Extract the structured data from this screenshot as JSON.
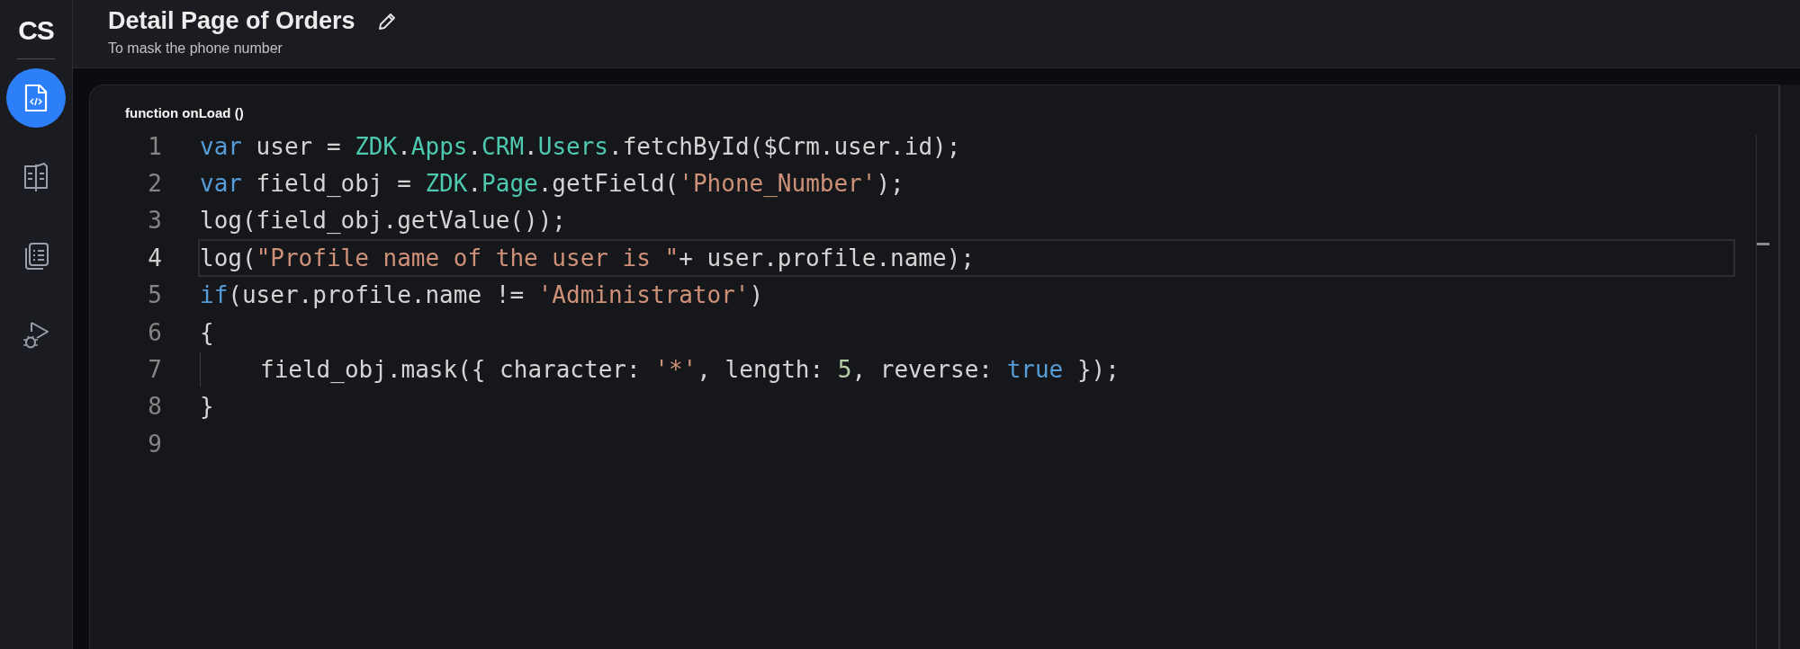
{
  "sidebar": {
    "logo": "CS",
    "items": [
      {
        "kind": "code",
        "selected": true
      },
      {
        "kind": "book",
        "selected": false
      },
      {
        "kind": "list",
        "selected": false
      },
      {
        "kind": "debug",
        "selected": false
      }
    ]
  },
  "header": {
    "title": "Detail Page of Orders",
    "subtitle": "To mask the phone number"
  },
  "editor": {
    "function_label": "function onLoad ()",
    "lines": [
      {
        "number": "1",
        "current": false,
        "indent_guide": false,
        "tokens": [
          {
            "kind": "keyword",
            "text": "var"
          },
          {
            "kind": "plain",
            "text": " user = "
          },
          {
            "kind": "type",
            "text": "ZDK"
          },
          {
            "kind": "plain",
            "text": "."
          },
          {
            "kind": "type",
            "text": "Apps"
          },
          {
            "kind": "plain",
            "text": "."
          },
          {
            "kind": "type",
            "text": "CRM"
          },
          {
            "kind": "plain",
            "text": "."
          },
          {
            "kind": "type",
            "text": "Users"
          },
          {
            "kind": "plain",
            "text": ".fetchById($Crm.user.id);"
          }
        ]
      },
      {
        "number": "2",
        "current": false,
        "indent_guide": false,
        "tokens": [
          {
            "kind": "keyword",
            "text": "var"
          },
          {
            "kind": "plain",
            "text": " field_obj = "
          },
          {
            "kind": "type",
            "text": "ZDK"
          },
          {
            "kind": "plain",
            "text": "."
          },
          {
            "kind": "type",
            "text": "Page"
          },
          {
            "kind": "plain",
            "text": ".getField("
          },
          {
            "kind": "string",
            "text": "'Phone_Number'"
          },
          {
            "kind": "plain",
            "text": ");"
          }
        ]
      },
      {
        "number": "3",
        "current": false,
        "indent_guide": false,
        "tokens": [
          {
            "kind": "plain",
            "text": "log(field_obj.getValue());"
          }
        ]
      },
      {
        "number": "4",
        "current": true,
        "indent_guide": false,
        "tokens": [
          {
            "kind": "plain",
            "text": "log("
          },
          {
            "kind": "string",
            "text": "\"Profile name of the user is \""
          },
          {
            "kind": "plain",
            "text": "+ user.profile.name);"
          }
        ]
      },
      {
        "number": "5",
        "current": false,
        "indent_guide": false,
        "tokens": [
          {
            "kind": "keyword",
            "text": "if"
          },
          {
            "kind": "plain",
            "text": "(user.profile.name != "
          },
          {
            "kind": "string",
            "text": "'Administrator'"
          },
          {
            "kind": "plain",
            "text": ")"
          }
        ]
      },
      {
        "number": "6",
        "current": false,
        "indent_guide": false,
        "tokens": [
          {
            "kind": "plain",
            "text": "{"
          }
        ]
      },
      {
        "number": "7",
        "current": false,
        "indent_guide": true,
        "tokens": [
          {
            "kind": "plain",
            "text": "field_obj.mask({ character: "
          },
          {
            "kind": "string",
            "text": "'*'"
          },
          {
            "kind": "plain",
            "text": ", length: "
          },
          {
            "kind": "number",
            "text": "5"
          },
          {
            "kind": "plain",
            "text": ", reverse: "
          },
          {
            "kind": "keyword",
            "text": "true"
          },
          {
            "kind": "plain",
            "text": " });"
          }
        ]
      },
      {
        "number": "8",
        "current": false,
        "indent_guide": false,
        "tokens": [
          {
            "kind": "plain",
            "text": "}"
          }
        ]
      },
      {
        "number": "9",
        "current": false,
        "indent_guide": false
      }
    ]
  }
}
